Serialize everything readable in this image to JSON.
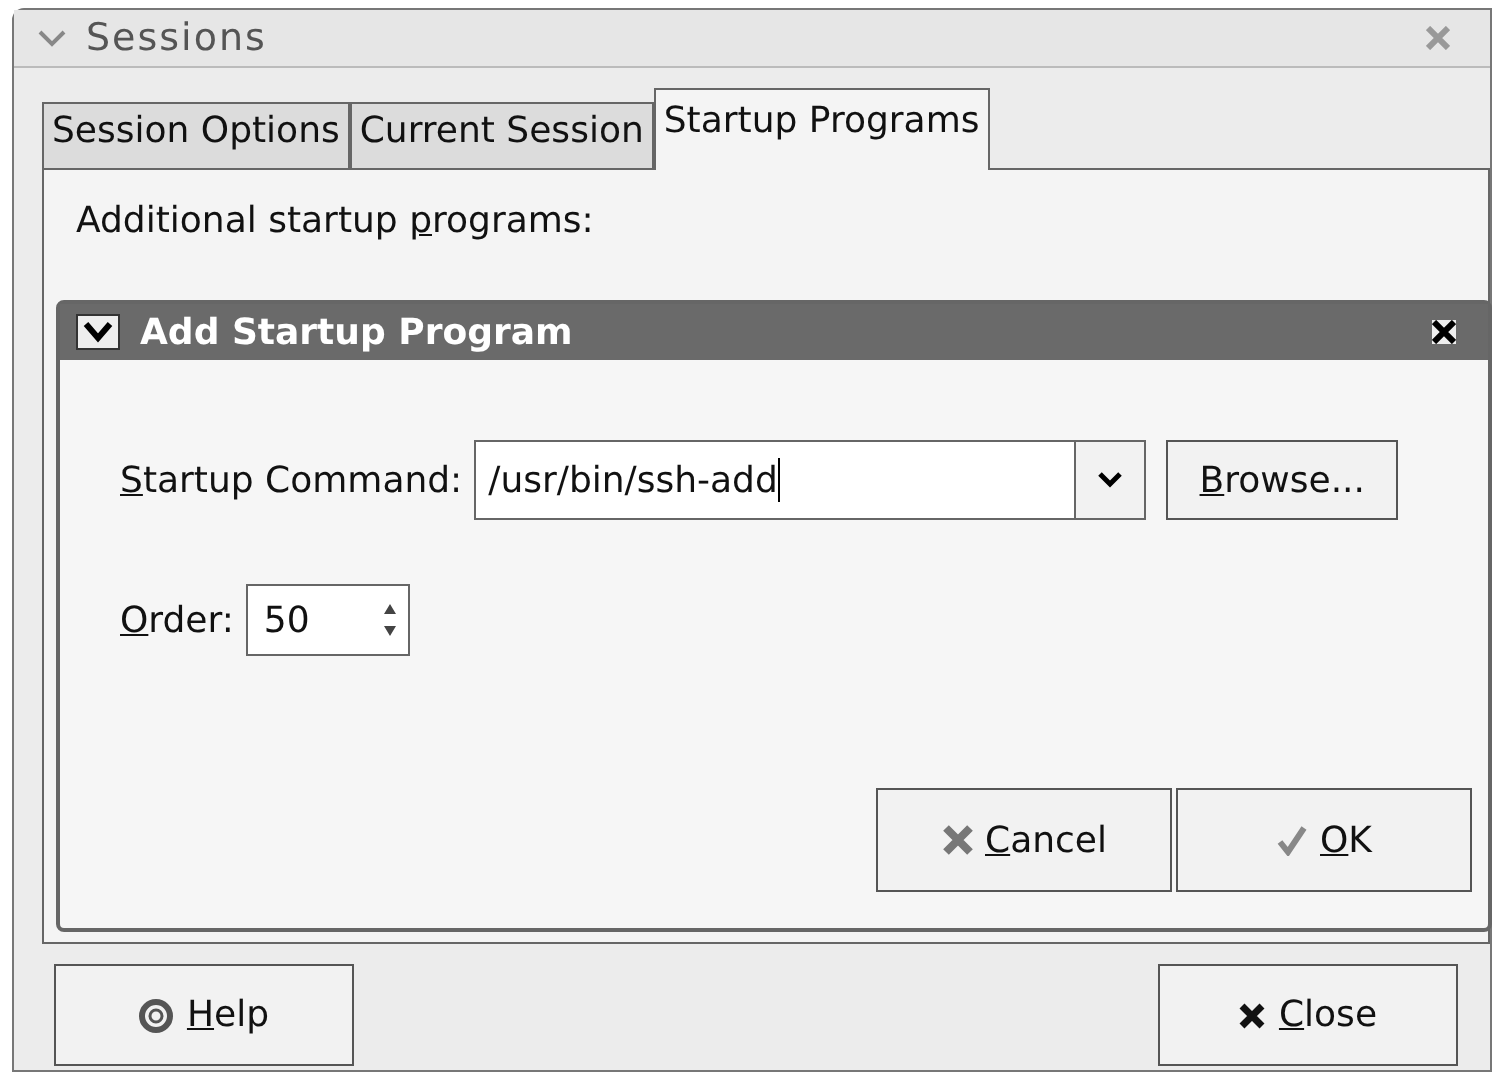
{
  "window": {
    "title": "Sessions"
  },
  "tabs": [
    {
      "label": "Session Options",
      "selected": false
    },
    {
      "label": "Current Session",
      "selected": false
    },
    {
      "label": "Startup Programs",
      "selected": true
    }
  ],
  "panel": {
    "label": [
      {
        "text": "Additional startup ",
        "underline": false
      },
      {
        "text": "p",
        "underline": true
      },
      {
        "text": "rograms:",
        "underline": false
      }
    ]
  },
  "dialog": {
    "title": "Add Startup Program",
    "command": {
      "label": [
        {
          "text": "S",
          "underline": true
        },
        {
          "text": "tartup Command:",
          "underline": false
        }
      ],
      "value": "/usr/bin/ssh-add"
    },
    "browse_button": {
      "label": [
        {
          "text": "B",
          "underline": true
        },
        {
          "text": "rowse...",
          "underline": false
        }
      ]
    },
    "order": {
      "label": [
        {
          "text": "O",
          "underline": true
        },
        {
          "text": "rder:",
          "underline": false
        }
      ],
      "value": "50"
    },
    "buttons": [
      {
        "kind": "cancel",
        "label": [
          {
            "text": "C",
            "underline": true
          },
          {
            "text": "ancel",
            "underline": false
          }
        ]
      },
      {
        "kind": "ok",
        "label": [
          {
            "text": "O",
            "underline": true
          },
          {
            "text": "K",
            "underline": false
          }
        ]
      }
    ]
  },
  "buttons": [
    {
      "kind": "help",
      "label": [
        {
          "text": "H",
          "underline": true
        },
        {
          "text": "elp",
          "underline": false
        }
      ]
    },
    {
      "kind": "close",
      "label": [
        {
          "text": "C",
          "underline": true
        },
        {
          "text": "lose",
          "underline": false
        }
      ]
    }
  ]
}
